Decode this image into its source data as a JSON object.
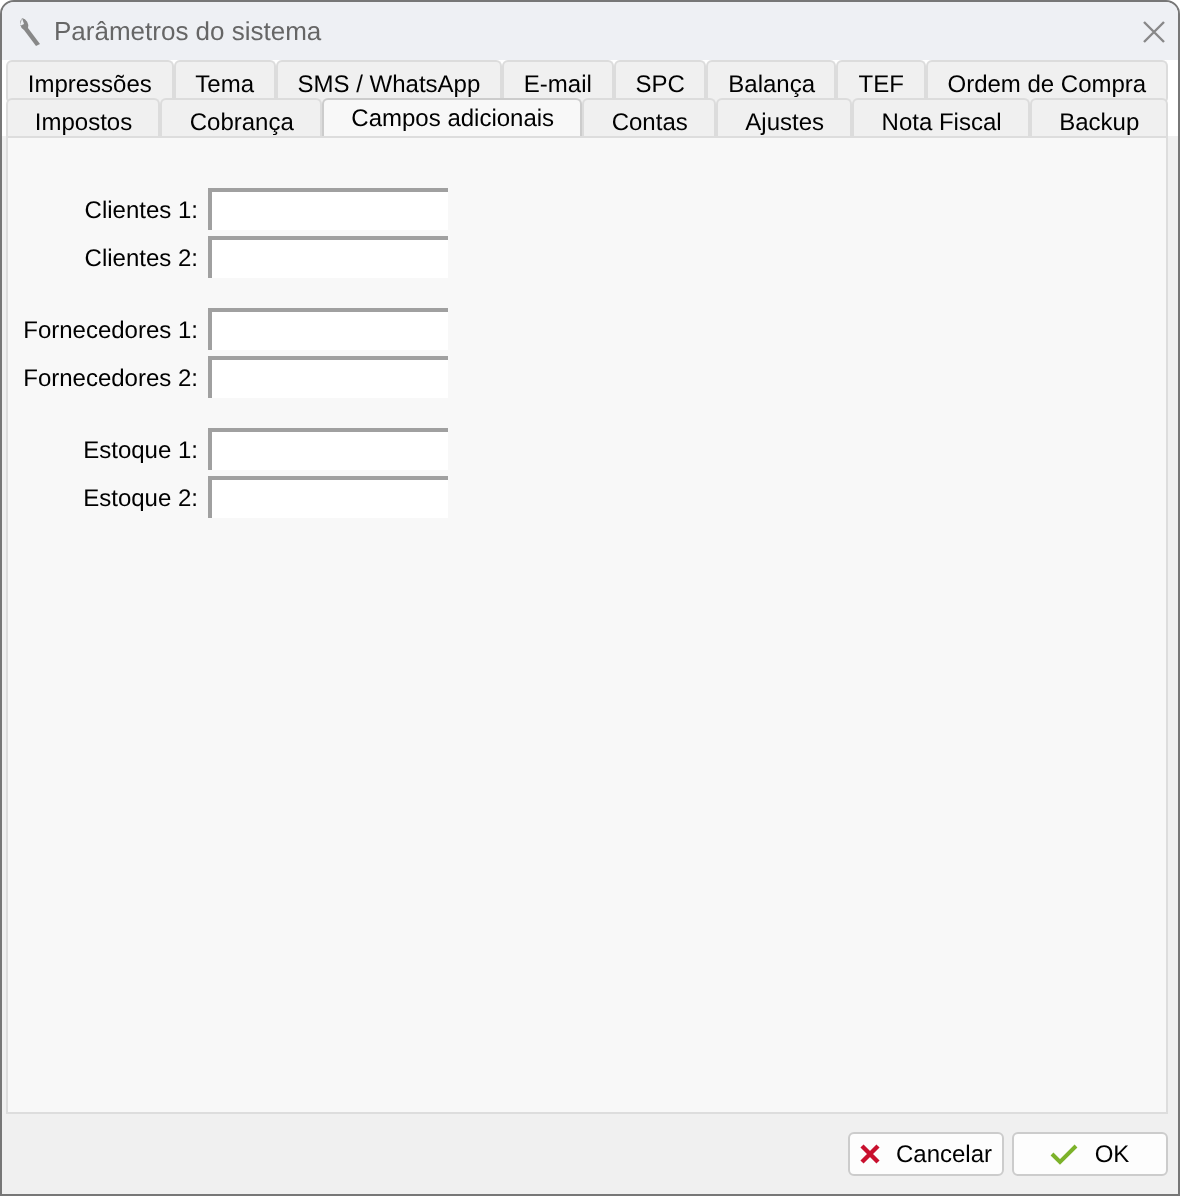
{
  "window": {
    "title": "Parâmetros do sistema"
  },
  "tab_rows": [
    [
      {
        "label": "Impressões",
        "selected": false
      },
      {
        "label": "Tema",
        "selected": false
      },
      {
        "label": "SMS / WhatsApp",
        "selected": false
      },
      {
        "label": "E-mail",
        "selected": false
      },
      {
        "label": "SPC",
        "selected": false
      },
      {
        "label": "Balança",
        "selected": false
      },
      {
        "label": "TEF",
        "selected": false
      },
      {
        "label": "Ordem de Compra",
        "selected": false
      }
    ],
    [
      {
        "label": "Impostos",
        "selected": false
      },
      {
        "label": "Cobrança",
        "selected": false
      },
      {
        "label": "Campos adicionais",
        "selected": true
      },
      {
        "label": "Contas",
        "selected": false
      },
      {
        "label": "Ajustes",
        "selected": false
      },
      {
        "label": "Nota Fiscal",
        "selected": false
      },
      {
        "label": "Backup",
        "selected": false
      }
    ]
  ],
  "field_groups": [
    {
      "fields": [
        {
          "label": "Clientes 1:"
        },
        {
          "label": "Clientes 2:"
        }
      ]
    },
    {
      "fields": [
        {
          "label": "Fornecedores 1:"
        },
        {
          "label": "Fornecedores 2:"
        }
      ]
    },
    {
      "fields": [
        {
          "label": "Estoque 1:"
        },
        {
          "label": "Estoque 2:"
        }
      ]
    }
  ],
  "buttons": [
    {
      "label": "Cancelar",
      "kind": "cancel"
    },
    {
      "label": "OK",
      "kind": "ok"
    }
  ]
}
